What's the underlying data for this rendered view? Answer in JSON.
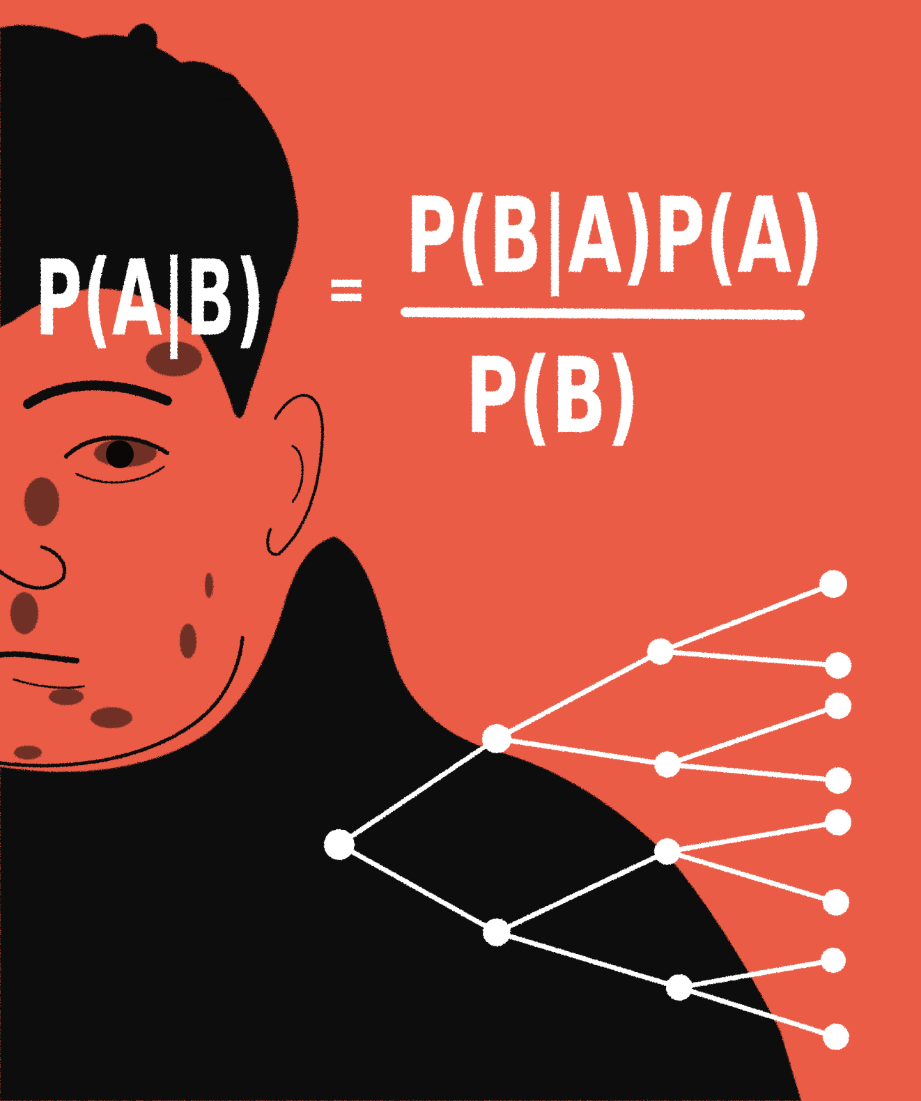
{
  "colors": {
    "background": "#ea5c46",
    "ink": "#0b0707",
    "chalk": "#ffffff"
  },
  "formula": {
    "lhs": "P(A|B)",
    "equals": "=",
    "numerator": "P(B|A)P(A)",
    "denominator": "P(B)"
  },
  "tree": {
    "levels": 4,
    "branching": 2,
    "leaf_count": 8
  }
}
